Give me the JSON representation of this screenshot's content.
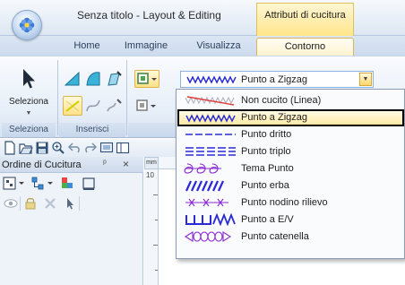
{
  "titlebar": {
    "title": "Senza titolo - Layout & Editing",
    "context_title": "Attributi di cucitura"
  },
  "tabs": [
    {
      "label": "Home"
    },
    {
      "label": "Immagine"
    },
    {
      "label": "Visualizza"
    },
    {
      "label": "Contorno",
      "active": true
    }
  ],
  "ribbon": {
    "select_label": "Seleziona",
    "groups": [
      {
        "label": "Seleziona"
      },
      {
        "label": "Inserisci"
      }
    ],
    "stitch_combo_value": "Punto a Zigzag"
  },
  "dropdown": {
    "items": [
      {
        "label": "Non cucito (Linea)",
        "icon": "non-sewn-line-icon"
      },
      {
        "label": "Punto a Zigzag",
        "icon": "zigzag-stitch-icon",
        "selected": true
      },
      {
        "label": "Punto dritto",
        "icon": "running-stitch-icon"
      },
      {
        "label": "Punto triplo",
        "icon": "triple-stitch-icon"
      },
      {
        "label": "Tema Punto",
        "icon": "motif-stitch-icon"
      },
      {
        "label": "Punto erba",
        "icon": "candlewicking-grass-icon"
      },
      {
        "label": "Punto nodino rilievo",
        "icon": "french-knot-icon"
      },
      {
        "label": "Punto a E/V",
        "icon": "ev-stitch-icon"
      },
      {
        "label": "Punto catenella",
        "icon": "chain-stitch-icon"
      }
    ]
  },
  "pane": {
    "title": "Ordine di Cucitura",
    "pin": "ᵖ",
    "close": "×"
  },
  "ruler": {
    "unit": "mm",
    "v_label": "10"
  },
  "colors": {
    "stitch_blue": "#2a2ad6",
    "non_sewn_red": "#e03a3a",
    "selection_fill": "#ffe9a5",
    "ribbon_highlight": "#ffe189"
  }
}
